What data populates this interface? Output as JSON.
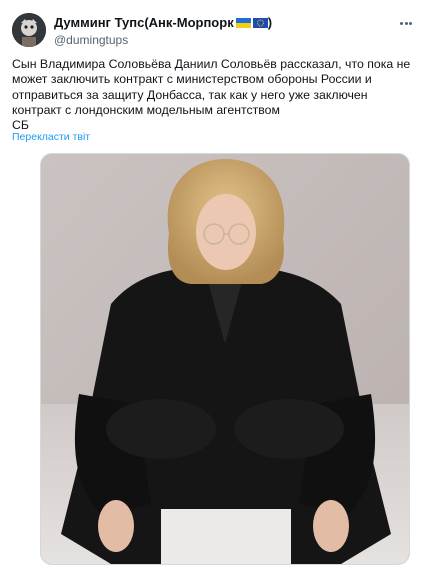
{
  "author": {
    "display_name": "Думминг Тупс(Анк-Морпорк",
    "display_name_close": ")",
    "handle": "@dumingtups",
    "flags": [
      "ukraine-flag",
      "eu-flag"
    ]
  },
  "tweet": {
    "text": "Сын Владимира Соловьёва Даниил Соловьёв рассказал, что пока не может заключить контракт с министерством обороны России и отправиться за защиту Донбасса, так как у него уже заключен контракт с лондонским модельным агентством",
    "signature": "СБ",
    "translate_label": "Перекласти твіт"
  },
  "media": {
    "type": "photo",
    "subject": "young man with long wavy blonde hair, round glasses, black suit, seated"
  },
  "colors": {
    "link": "#1d9bf0",
    "secondary_text": "#536471",
    "border": "#cfd9de"
  }
}
